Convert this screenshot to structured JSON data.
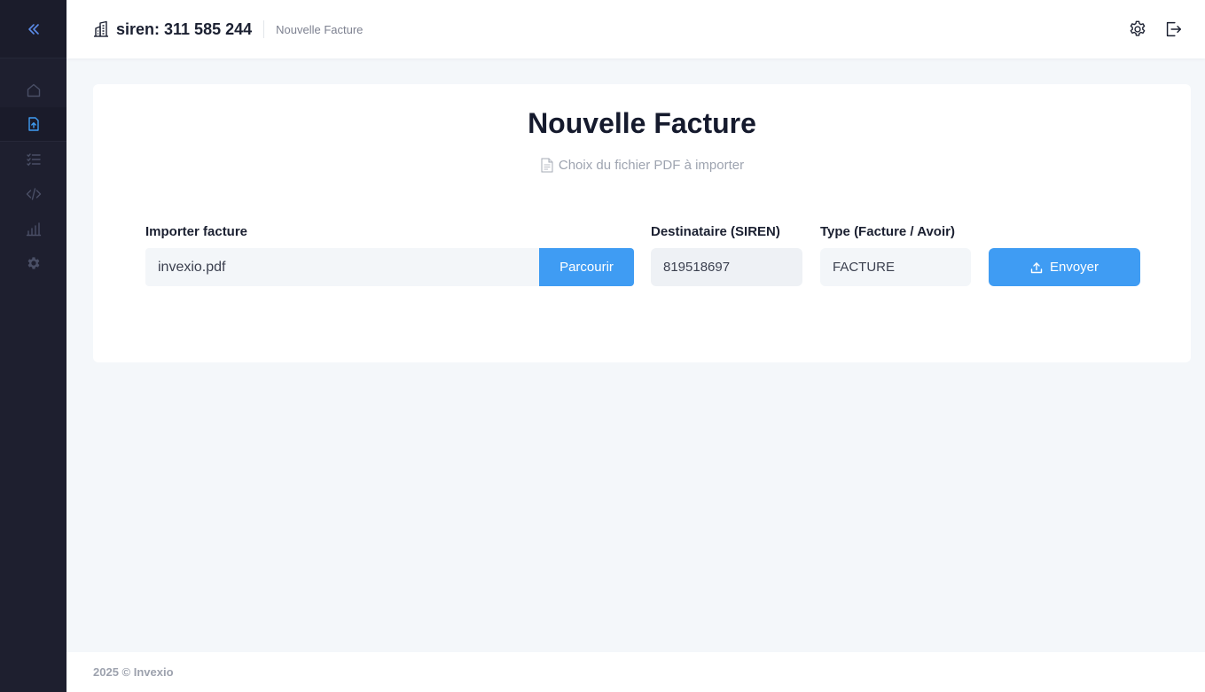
{
  "header": {
    "title": "siren: 311 585 244",
    "breadcrumb": "Nouvelle Facture"
  },
  "sidebar": {
    "items": [
      {
        "name": "home",
        "icon": "home-icon"
      },
      {
        "name": "upload",
        "icon": "file-upload-icon",
        "active": true
      },
      {
        "name": "list",
        "icon": "list-check-icon"
      },
      {
        "name": "code",
        "icon": "code-icon"
      },
      {
        "name": "stats",
        "icon": "bar-chart-icon"
      },
      {
        "name": "settings",
        "icon": "gear-icon"
      }
    ]
  },
  "card": {
    "title": "Nouvelle Facture",
    "subtitle": "Choix du fichier PDF à importer",
    "import": {
      "label": "Importer facture",
      "value": "invexio.pdf",
      "browse_label": "Parcourir"
    },
    "recipient": {
      "label": "Destinataire (SIREN)",
      "value": "819518697"
    },
    "type": {
      "label": "Type (Facture / Avoir)",
      "value": "FACTURE"
    },
    "send_label": "Envoyer"
  },
  "footer": {
    "text": "2025 © Invexio"
  },
  "colors": {
    "accent": "#3f9cf3",
    "sidebar_bg": "#1e1f2f",
    "page_bg": "#f4f7fa"
  }
}
